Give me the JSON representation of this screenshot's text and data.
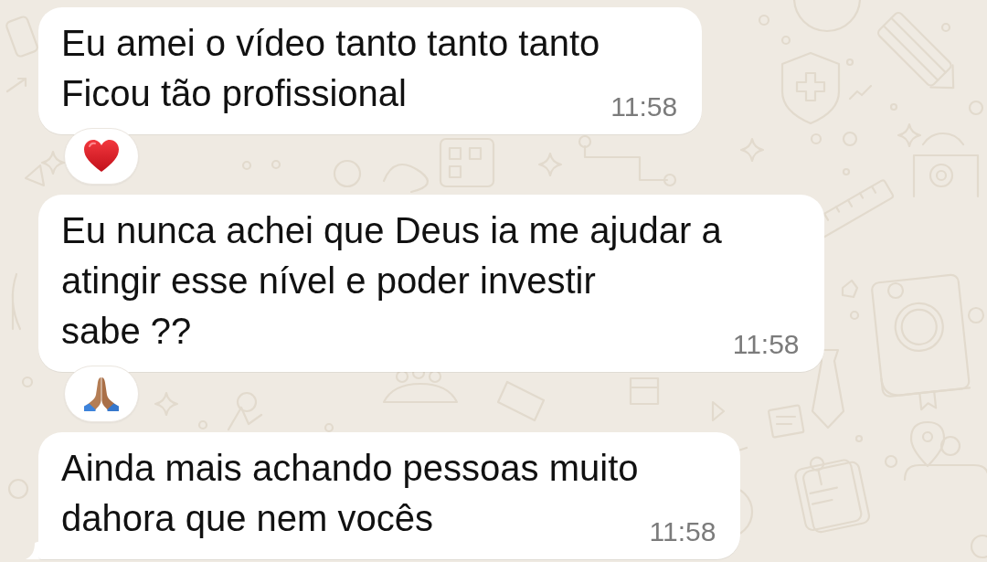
{
  "messages": [
    {
      "text": "Eu amei o vídeo tanto tanto tanto\nFicou tão profissional",
      "time": "11:58",
      "tail": false,
      "reaction": {
        "kind": "heart"
      }
    },
    {
      "text": "Eu nunca achei que Deus ia me ajudar a\natingir esse nível e poder investir\nsabe ??",
      "time": "11:58",
      "tail": false,
      "reaction": {
        "kind": "pray"
      }
    },
    {
      "text": "Ainda mais achando pessoas muito\ndahora que nem vocês",
      "time": "11:58",
      "tail": true
    }
  ]
}
